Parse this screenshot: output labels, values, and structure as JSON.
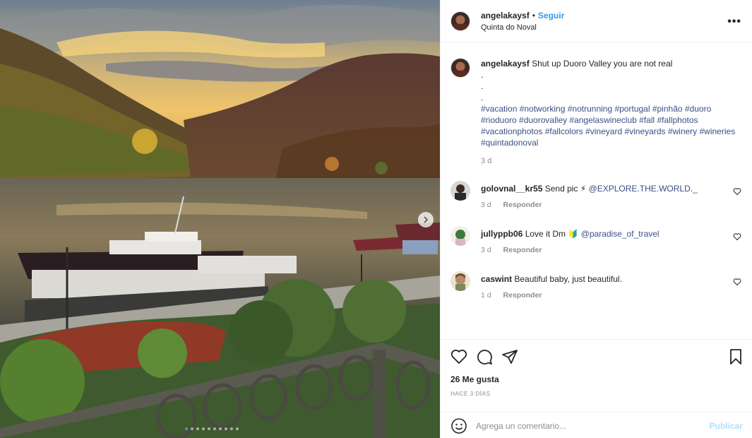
{
  "post": {
    "author": "angelakaysf",
    "follow_label": "Seguir",
    "separator": "•",
    "location": "Quinta do Noval",
    "more_label": "•••"
  },
  "caption": {
    "username": "angelakaysf",
    "text": "Shut up Duoro Valley you are not real",
    "dots": [
      ".",
      ".",
      "."
    ],
    "hashtags": "#vacation #notworking #notrunning #portugal #pinhão #duoro #rioduoro #duorovalley #angelaswineclub #fall #fallphotos #vacationphotos #fallcolors #vineyard #vineyards #winery #wineries #quintadonoval",
    "time": "3 d"
  },
  "comments": [
    {
      "username": "golovnal__kr55",
      "text": "Send pic ⚡",
      "mention": "@EXPLORE.THE.WORLD._",
      "time": "3 d",
      "reply_label": "Responder"
    },
    {
      "username": "jullyppb06",
      "text": "Love it Dm 🔰",
      "mention": "@paradise_of_travel",
      "time": "3 d",
      "reply_label": "Responder"
    },
    {
      "username": "caswint",
      "text": "Beautiful baby, just beautiful.",
      "mention": "",
      "time": "1 d",
      "reply_label": "Responder"
    }
  ],
  "engagement": {
    "likes": "26 Me gusta",
    "posted": "HACE 3 DÍAS"
  },
  "composer": {
    "placeholder": "Agrega un comentario...",
    "publish_label": "Publicar"
  },
  "carousel": {
    "slide_count": 10,
    "active_index": 0
  },
  "colors": {
    "link": "#3897f0",
    "hashtag": "#385185",
    "muted": "#8e8e8e",
    "publish_disabled": "#b2dffc"
  },
  "icons": {
    "like": "heart-icon",
    "comment": "comment-bubble-icon",
    "share": "paper-plane-icon",
    "save": "bookmark-icon",
    "emoji": "smiley-icon",
    "next": "chevron-right-icon",
    "more": "ellipsis-icon"
  }
}
